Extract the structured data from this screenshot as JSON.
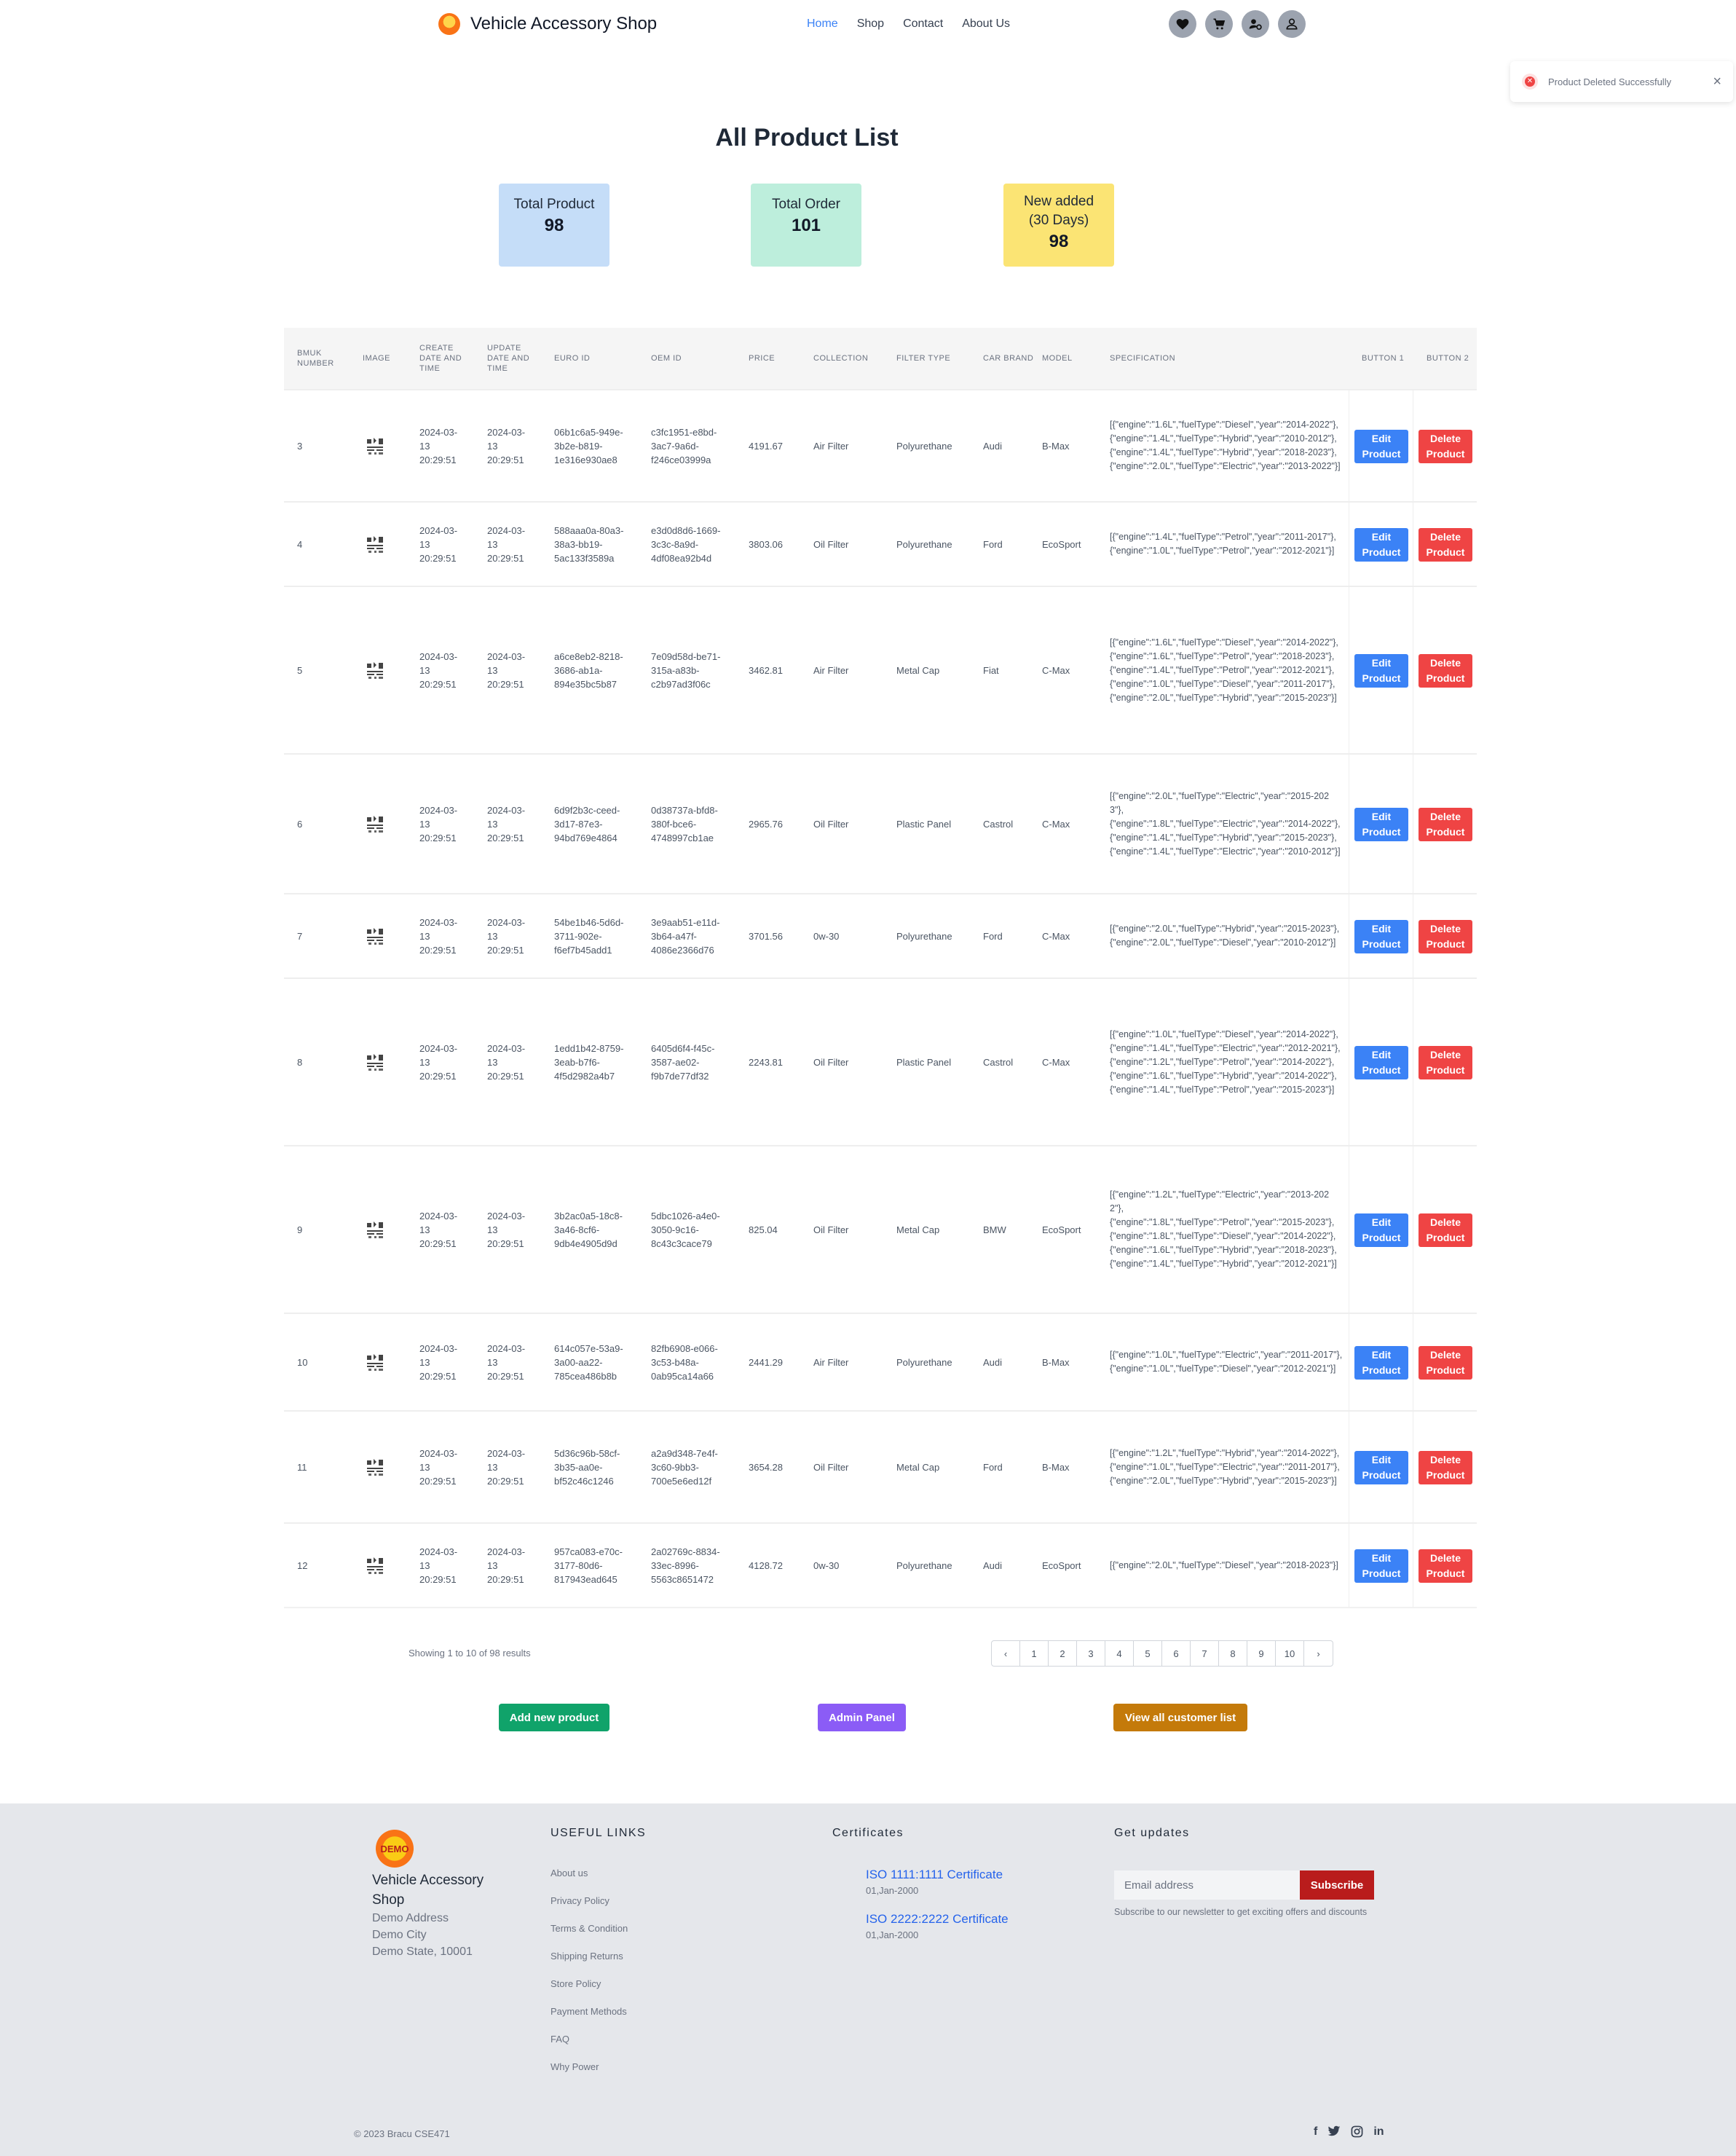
{
  "nav": {
    "brand": "Vehicle Accessory Shop",
    "links": [
      "Home",
      "Shop",
      "Contact",
      "About Us"
    ],
    "active": "Home",
    "icons": [
      "heart-icon",
      "cart-icon",
      "admin-user-icon",
      "user-icon"
    ]
  },
  "toast": {
    "message": "Product Deleted Successfully",
    "close": "×"
  },
  "page": {
    "title": "All Product List"
  },
  "stats": [
    {
      "label": "Total Product",
      "value": "98",
      "color": "#c5ddf8"
    },
    {
      "label": "Total Order",
      "value": "101",
      "color": "#bdeedc"
    },
    {
      "label": "New added (30 Days)",
      "value": "98",
      "color": "#fbe474"
    }
  ],
  "table": {
    "headers": [
      "BMUK NUMBER",
      "IMAGE",
      "CREATE DATE AND TIME",
      "UPDATE DATE AND TIME",
      "EURO ID",
      "OEM ID",
      "PRICE",
      "COLLECTION",
      "FILTER TYPE",
      "CAR BRAND",
      "MODEL",
      "SPECIFICATION",
      "BUTTON 1",
      "BUTTON 2"
    ],
    "edit_label": "Edit Product",
    "delete_label": "Delete Product",
    "rows": [
      {
        "num": "3",
        "created": "2024-03-13 20:29:51",
        "updated": "2024-03-13 20:29:51",
        "euro": "06b1c6a5-949e-3b2e-b819-1e316e930ae8",
        "oem": "c3fc1951-e8bd-3ac7-9a6d-f246ce03999a",
        "price": "4191.67",
        "collection": "Air Filter",
        "filter": "Polyurethane",
        "brand": "Audi",
        "model": "B-Max",
        "spec": "[{\"engine\":\"1.6L\",\"fuelType\":\"Diesel\",\"year\":\"2014-2022\"},\n{\"engine\":\"1.4L\",\"fuelType\":\"Hybrid\",\"year\":\"2010-2012\"},\n{\"engine\":\"1.4L\",\"fuelType\":\"Hybrid\",\"year\":\"2018-2023\"},\n{\"engine\":\"2.0L\",\"fuelType\":\"Electric\",\"year\":\"2013-2022\"}]"
      },
      {
        "num": "4",
        "created": "2024-03-13 20:29:51",
        "updated": "2024-03-13 20:29:51",
        "euro": "588aaa0a-80a3-38a3-bb19-5ac133f3589a",
        "oem": "e3d0d8d6-1669-3c3c-8a9d-4df08ea92b4d",
        "price": "3803.06",
        "collection": "Oil Filter",
        "filter": "Polyurethane",
        "brand": "Ford",
        "model": "EcoSport",
        "spec": "[{\"engine\":\"1.4L\",\"fuelType\":\"Petrol\",\"year\":\"2011-2017\"},\n{\"engine\":\"1.0L\",\"fuelType\":\"Petrol\",\"year\":\"2012-2021\"}]"
      },
      {
        "num": "5",
        "created": "2024-03-13 20:29:51",
        "updated": "2024-03-13 20:29:51",
        "euro": "a6ce8eb2-8218-3686-ab1a-894e35bc5b87",
        "oem": "7e09d58d-be71-315a-a83b-c2b97ad3f06c",
        "price": "3462.81",
        "collection": "Air Filter",
        "filter": "Metal Cap",
        "brand": "Fiat",
        "model": "C-Max",
        "spec": "[{\"engine\":\"1.6L\",\"fuelType\":\"Diesel\",\"year\":\"2014-2022\"},\n{\"engine\":\"1.6L\",\"fuelType\":\"Petrol\",\"year\":\"2018-2023\"},\n{\"engine\":\"1.4L\",\"fuelType\":\"Petrol\",\"year\":\"2012-2021\"},\n{\"engine\":\"1.0L\",\"fuelType\":\"Diesel\",\"year\":\"2011-2017\"},\n{\"engine\":\"2.0L\",\"fuelType\":\"Hybrid\",\"year\":\"2015-2023\"}]"
      },
      {
        "num": "6",
        "created": "2024-03-13 20:29:51",
        "updated": "2024-03-13 20:29:51",
        "euro": "6d9f2b3c-ceed-3d17-87e3-94bd769e4864",
        "oem": "0d38737a-bfd8-380f-bce6-4748997cb1ae",
        "price": "2965.76",
        "collection": "Oil Filter",
        "filter": "Plastic Panel",
        "brand": "Castrol",
        "model": "C-Max",
        "spec": "[{\"engine\":\"2.0L\",\"fuelType\":\"Electric\",\"year\":\"2015-2023\"},\n{\"engine\":\"1.8L\",\"fuelType\":\"Electric\",\"year\":\"2014-2022\"},\n{\"engine\":\"1.4L\",\"fuelType\":\"Hybrid\",\"year\":\"2015-2023\"},\n{\"engine\":\"1.4L\",\"fuelType\":\"Electric\",\"year\":\"2010-2012\"}]"
      },
      {
        "num": "7",
        "created": "2024-03-13 20:29:51",
        "updated": "2024-03-13 20:29:51",
        "euro": "54be1b46-5d6d-3711-902e-f6ef7b45add1",
        "oem": "3e9aab51-e11d-3b64-a47f-4086e2366d76",
        "price": "3701.56",
        "collection": "0w-30",
        "filter": "Polyurethane",
        "brand": "Ford",
        "model": "C-Max",
        "spec": "[{\"engine\":\"2.0L\",\"fuelType\":\"Hybrid\",\"year\":\"2015-2023\"},\n{\"engine\":\"2.0L\",\"fuelType\":\"Diesel\",\"year\":\"2010-2012\"}]"
      },
      {
        "num": "8",
        "created": "2024-03-13 20:29:51",
        "updated": "2024-03-13 20:29:51",
        "euro": "1edd1b42-8759-3eab-b7f6-4f5d2982a4b7",
        "oem": "6405d6f4-f45c-3587-ae02-f9b7de77df32",
        "price": "2243.81",
        "collection": "Oil Filter",
        "filter": "Plastic Panel",
        "brand": "Castrol",
        "model": "C-Max",
        "spec": "[{\"engine\":\"1.0L\",\"fuelType\":\"Diesel\",\"year\":\"2014-2022\"},\n{\"engine\":\"1.4L\",\"fuelType\":\"Electric\",\"year\":\"2012-2021\"},\n{\"engine\":\"1.2L\",\"fuelType\":\"Petrol\",\"year\":\"2014-2022\"},\n{\"engine\":\"1.6L\",\"fuelType\":\"Hybrid\",\"year\":\"2014-2022\"},\n{\"engine\":\"1.4L\",\"fuelType\":\"Petrol\",\"year\":\"2015-2023\"}]"
      },
      {
        "num": "9",
        "created": "2024-03-13 20:29:51",
        "updated": "2024-03-13 20:29:51",
        "euro": "3b2ac0a5-18c8-3a46-8cf6-9db4e4905d9d",
        "oem": "5dbc1026-a4e0-3050-9c16-8c43c3cace79",
        "price": "825.04",
        "collection": "Oil Filter",
        "filter": "Metal Cap",
        "brand": "BMW",
        "model": "EcoSport",
        "spec": "[{\"engine\":\"1.2L\",\"fuelType\":\"Electric\",\"year\":\"2013-2022\"},\n{\"engine\":\"1.8L\",\"fuelType\":\"Petrol\",\"year\":\"2015-2023\"},\n{\"engine\":\"1.8L\",\"fuelType\":\"Diesel\",\"year\":\"2014-2022\"},\n{\"engine\":\"1.6L\",\"fuelType\":\"Hybrid\",\"year\":\"2018-2023\"},\n{\"engine\":\"1.4L\",\"fuelType\":\"Hybrid\",\"year\":\"2012-2021\"}]"
      },
      {
        "num": "10",
        "created": "2024-03-13 20:29:51",
        "updated": "2024-03-13 20:29:51",
        "euro": "614c057e-53a9-3a00-aa22-785cea486b8b",
        "oem": "82fb6908-e066-3c53-b48a-0ab95ca14a66",
        "price": "2441.29",
        "collection": "Air Filter",
        "filter": "Polyurethane",
        "brand": "Audi",
        "model": "B-Max",
        "spec": "[{\"engine\":\"1.0L\",\"fuelType\":\"Electric\",\"year\":\"2011-2017\"},\n{\"engine\":\"1.0L\",\"fuelType\":\"Diesel\",\"year\":\"2012-2021\"}]"
      },
      {
        "num": "11",
        "created": "2024-03-13 20:29:51",
        "updated": "2024-03-13 20:29:51",
        "euro": "5d36c96b-58cf-3b35-aa0e-bf52c46c1246",
        "oem": "a2a9d348-7e4f-3c60-9bb3-700e5e6ed12f",
        "price": "3654.28",
        "collection": "Oil Filter",
        "filter": "Metal Cap",
        "brand": "Ford",
        "model": "B-Max",
        "spec": "[{\"engine\":\"1.2L\",\"fuelType\":\"Hybrid\",\"year\":\"2014-2022\"},\n{\"engine\":\"1.0L\",\"fuelType\":\"Electric\",\"year\":\"2011-2017\"},\n{\"engine\":\"2.0L\",\"fuelType\":\"Hybrid\",\"year\":\"2015-2023\"}]"
      },
      {
        "num": "12",
        "created": "2024-03-13 20:29:51",
        "updated": "2024-03-13 20:29:51",
        "euro": "957ca083-e70c-3177-80d6-817943ead645",
        "oem": "2a02769c-8834-33ec-8996-5563c8651472",
        "price": "4128.72",
        "collection": "0w-30",
        "filter": "Polyurethane",
        "brand": "Audi",
        "model": "EcoSport",
        "spec": "[{\"engine\":\"2.0L\",\"fuelType\":\"Diesel\",\"year\":\"2018-2023\"}]"
      }
    ]
  },
  "pagination": {
    "showing": "Showing 1 to 10 of 98 results",
    "prev": "‹",
    "pages": [
      "1",
      "2",
      "3",
      "4",
      "5",
      "6",
      "7",
      "8",
      "9",
      "10"
    ],
    "next": "›"
  },
  "actions": {
    "add": {
      "label": "Add new product",
      "color": "#10a36a"
    },
    "admin": {
      "label": "Admin Panel",
      "color": "#8b5cf6"
    },
    "customers": {
      "label": "View all customer list",
      "color": "#c47a0a"
    }
  },
  "footer": {
    "logo_text": "DEMO",
    "brand": "Vehicle Accessory Shop",
    "address": [
      "Demo Address",
      "Demo City",
      "Demo State, 10001"
    ],
    "useful_title": "USEFUL LINKS",
    "useful_links": [
      "About us",
      "Privacy Policy",
      "Terms & Condition",
      "Shipping Returns",
      "Store Policy",
      "Payment Methods",
      "FAQ",
      "Why Power"
    ],
    "cert_title": "Certificates",
    "certs": [
      {
        "name": "ISO 1111:1111 Certificate",
        "date": "01,Jan-2000"
      },
      {
        "name": "ISO 2222:2222 Certificate",
        "date": "01,Jan-2000"
      }
    ],
    "updates_title": "Get updates",
    "email_placeholder": "Email address",
    "subscribe": "Subscribe",
    "note": "Subscribe to our newsletter to get exciting offers and discounts",
    "copyright": "© 2023 Bracu CSE471",
    "socials": [
      "facebook-icon",
      "twitter-icon",
      "instagram-icon",
      "linkedin-icon"
    ]
  }
}
